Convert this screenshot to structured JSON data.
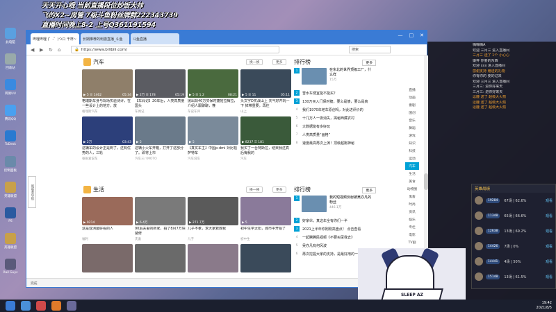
{
  "overlay": {
    "line1": "天天开心哦 当前直播段位炒饭大帅",
    "line2": "飞的X2~房管 7级斗鱼粉丝牌群222343739",
    "line3": "直播时间晚上8-2 上号Q361191594"
  },
  "desktop": {
    "icons": [
      "此电脑",
      "回收站",
      "网易UU",
      "腾讯QQ",
      "ToDesk",
      "控制面板",
      "英雄联盟",
      "PS",
      "英雄联盟",
      "Rail Guys"
    ]
  },
  "browser": {
    "tabs": [
      "哔哩哔哩 (゜-゜)つロ 干杯~",
      "长期推荐的刺激直播_斗鱼",
      "斗鱼直播"
    ],
    "url": "https://www.bilibili.com/",
    "search_placeholder": "搜索"
  },
  "sections": [
    {
      "title": "汽车",
      "refresh": "换一换",
      "more": "更多",
      "videos": [
        {
          "title": "格瑞斯车身与现场实验测评，在一些设计上的地方，放",
          "up": "格瑞斯汽车",
          "views": "5",
          "likes": "1462",
          "dur": "05:34",
          "color": "#8f7f6a"
        },
        {
          "title": "【车闻记】20年后，人类高质量国头",
          "up": "车闻记",
          "views": "2万",
          "likes": "178",
          "dur": "05:19",
          "color": "#5b5c62"
        },
        {
          "title": "抛出现40万买保时捷帕拉梅拉，介绍人跟聊聊，懂",
          "up": "车说车评",
          "views": "5",
          "likes": "1.2",
          "dur": "08:21",
          "color": "#4a6a3e"
        },
        {
          "title": "头文字D实战山上 天气好开玩一下 掉带重要，再往",
          "up": "山上",
          "views": "5",
          "likes": "11",
          "dur": "05:11",
          "color": "#3a4a5a"
        },
        {
          "title": "这辆车的设计正是到了，还有优势的人，三轮",
          "up": "张张爱说车",
          "views": "2万",
          "likes": "",
          "dur": "03:43",
          "color": "#2c3f7a"
        },
        {
          "title": "这辆小火车开箱，打开了这部分了。即将上市",
          "up": "汽车三八MOTO",
          "views": "5",
          "likes": "",
          "dur": "",
          "color": "#6a7a8a"
        },
        {
          "title": "【真实车主】中国p-dmi 对比帕萨特车",
          "up": "汽车说车",
          "views": "5",
          "likes": "",
          "dur": "",
          "color": "#7a8a9a"
        },
        {
          "title": "我买了一台特斯拉，结果我还真后悔我的",
          "up": "汽车",
          "views": "8237",
          "likes": "181",
          "dur": "",
          "color": "#3a5a3a"
        }
      ]
    },
    {
      "title": "生活",
      "refresh": "换一换",
      "more": "更多",
      "videos": [
        {
          "title": "这是亚洲最好看的人",
          "up": "福利",
          "views": "9214",
          "likes": "",
          "dur": "",
          "color": "#9a6a5a"
        },
        {
          "title": "90后夫妻的新家，拍了8月7万块装修",
          "up": "夫妻",
          "views": "6.4万",
          "likes": "",
          "dur": "",
          "color": "#7a7a7a"
        },
        {
          "title": "儿子不孝，求大家救救我",
          "up": "儿子",
          "views": "271.7万",
          "likes": "",
          "dur": "",
          "color": "#5a5a5a"
        },
        {
          "title": "初中生学太阳，城市中开始了",
          "up": "初中生",
          "views": "5",
          "likes": "",
          "dur": "",
          "color": "#8a7a9a"
        },
        {
          "title": "",
          "up": "",
          "views": "",
          "likes": "",
          "dur": "",
          "color": "#7a6a6a"
        },
        {
          "title": "",
          "up": "",
          "views": "",
          "likes": "",
          "dur": "",
          "color": "#6a6a6a"
        },
        {
          "title": "",
          "up": "",
          "views": "",
          "likes": "",
          "dur": "",
          "color": "#8a7a8a"
        },
        {
          "title": "",
          "up": "",
          "views": "",
          "likes": "",
          "dur": "",
          "color": "#3a4a5a"
        }
      ]
    }
  ],
  "ranks": [
    {
      "title": "排行榜",
      "more": "更多",
      "top": {
        "title": "在东北的世界顶级工厂，什么样",
        "count": "15万"
      },
      "items": [
        "雪水车便宜能不能买？",
        "130万买入门保时捷，要么是傻，要么是真",
        "我们1970年老车原创吗，对此进评价的",
        "十几万人一夜消失，揭秘西藏农村",
        "大数据能有多好玩",
        "人类高质量“画格”",
        "速度最高再次上演！顶级超跑神秘"
      ]
    },
    {
      "title": "排行榜",
      "more": "更多",
      "top": {
        "title": "我的短视频反射被吴亦凡的粉丝",
        "count": "446.1万"
      },
      "items": [
        "好家伙，真这年全有你们一半",
        "2021上半年你刚刚高盘点！ 点击查看",
        "一起腾腾民视频《不要买尿我去》",
        "吴亦凡有何风波",
        "再次挖掘大家的支持，是最好用的一"
      ]
    }
  ],
  "side_nav": [
    "直播",
    "动画",
    "番剧",
    "国创",
    "音乐",
    "舞蹈",
    "游戏",
    "知识",
    "科技",
    "运动",
    "汽车",
    "生活",
    "美食",
    "动物圈",
    "鬼畜",
    "时尚",
    "资讯",
    "娱乐",
    "专栏",
    "电影",
    "TV剧",
    "影视",
    "纪录片"
  ],
  "side_nav_active": "汽车",
  "left_float": "新版本导航",
  "statusbar": {
    "left": "完成",
    "right": "热点资讯",
    "zoom": "100%"
  },
  "chat": [
    {
      "t": "嗨嗨嗨A",
      "o": false
    },
    {
      "t": "欢迎 三月三 进入直播间",
      "o": false
    },
    {
      "t": "三月三 送了 1个 小心心",
      "o": true
    },
    {
      "t": "嫌弃 你要的东西",
      "o": false
    },
    {
      "t": "欢迎 xxx 进入直播间",
      "o": false
    },
    {
      "t": "感谢支持 赠送的礼物",
      "o": true
    },
    {
      "t": "你有你的 要的过来",
      "o": false
    },
    {
      "t": "欢迎 三月三 进入直播间",
      "o": false
    },
    {
      "t": "三月三: 进你好来天",
      "o": false
    },
    {
      "t": "三月三: 进你好来天",
      "o": false
    },
    {
      "t": "逗鹿 送了 超级大火箭",
      "o": true
    },
    {
      "t": "逗鹿 送了 超级大火箭",
      "o": true
    },
    {
      "t": "逗鹿 送了 超级大火箭",
      "o": true
    }
  ],
  "ranking_panel": {
    "title": "英雄战绩",
    "rows": [
      {
        "score": "19284",
        "rec": "67场 | 62.6%",
        "w": "观看"
      },
      {
        "score": "11348",
        "rec": "65场 | 66.6%",
        "w": "观看"
      },
      {
        "score": "12638",
        "rec": "13场 | 69.2%",
        "w": "观看"
      },
      {
        "score": "14426",
        "rec": "7场 | 0%",
        "w": "观看"
      },
      {
        "score": "14441",
        "rec": "4场 | 50%",
        "w": "观看"
      },
      {
        "score": "15148",
        "rec": "13场 | 61.5%",
        "w": "观看"
      }
    ]
  },
  "cam_sign": "SLEEP AZ",
  "clock": {
    "time": "19:42",
    "date": "2021/8/5"
  }
}
